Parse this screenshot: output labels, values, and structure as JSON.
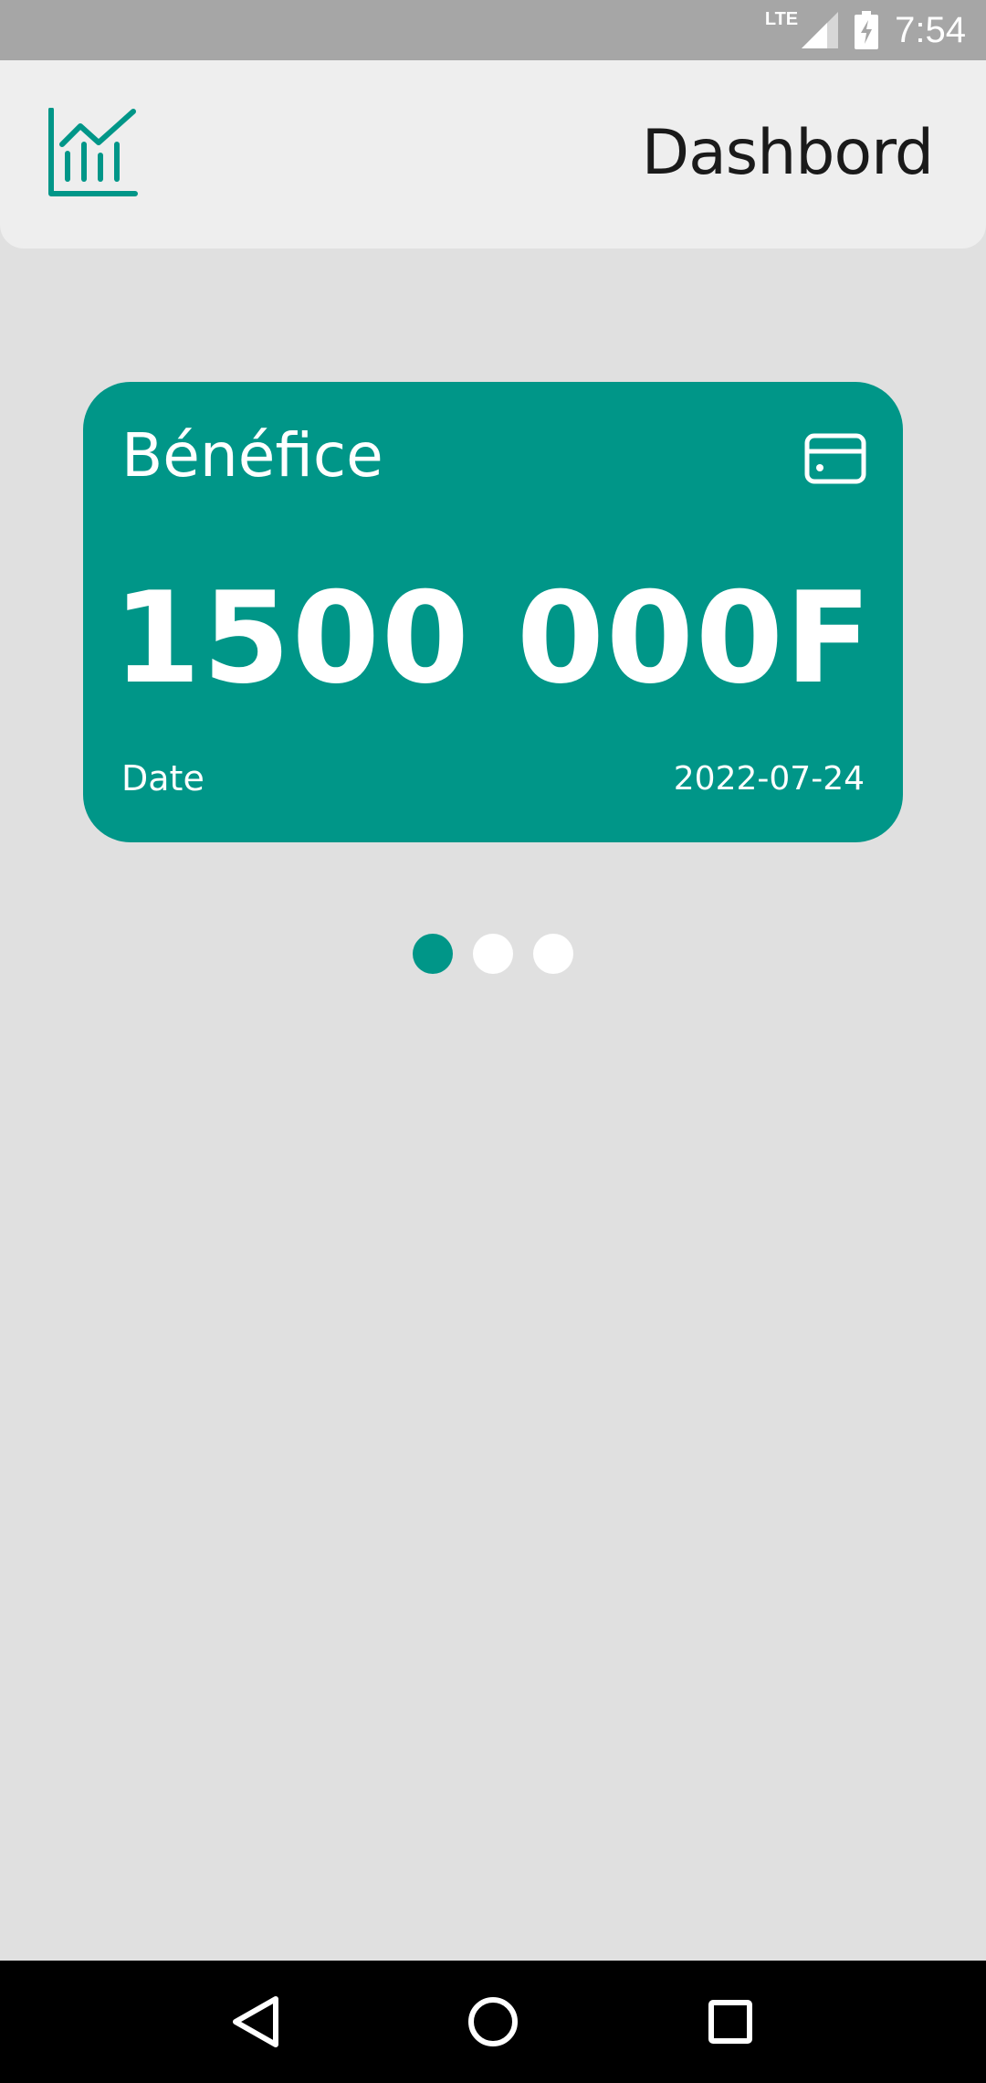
{
  "status_bar": {
    "network": "LTE",
    "time": "7:54",
    "icons": [
      "signal-icon",
      "battery-charging-icon"
    ]
  },
  "header": {
    "logo_icon": "chart-icon",
    "title": "Dashbord"
  },
  "card": {
    "title": "Bénéfice",
    "icon": "credit-card-icon",
    "amount": "1500 000F",
    "date_label": "Date",
    "date_value": "2022-07-24",
    "background_color": "#009688"
  },
  "pager": {
    "count": 3,
    "active_index": 0,
    "active_color": "#009688",
    "inactive_color": "#ffffff"
  },
  "nav_bar": {
    "buttons": [
      "back-icon",
      "home-icon",
      "recents-icon"
    ]
  }
}
